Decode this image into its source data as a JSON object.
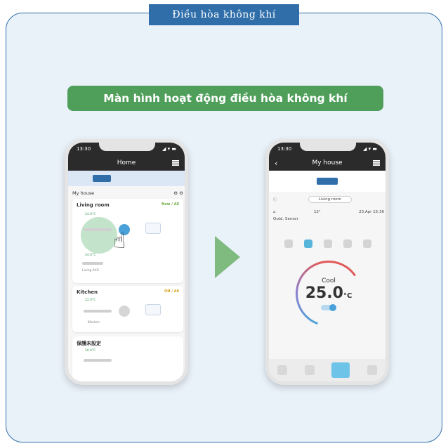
{
  "header": {
    "tab_title": "Điều hòa không khí"
  },
  "banner": {
    "title": "Màn hình hoạt động điều hòa không khí"
  },
  "colors": {
    "frame": "#2f6ea9",
    "banner": "#4f9e5a",
    "arrow": "#7fba7f"
  },
  "left_phone": {
    "status_time": "13:30",
    "status_icons": "◢ ▾ ▬",
    "app_title": "Home",
    "house_label": "My house",
    "rooms": [
      {
        "name": "Living room",
        "status": "Now / All",
        "temp_top": "24.0°C",
        "label": "Living ACS",
        "temp_bottom": "24.0°C"
      },
      {
        "name": "Kitchen",
        "status": "ON / All",
        "temp_top": "22.0°C",
        "label": "Kitchen"
      },
      {
        "name": "保護未設定",
        "temp_top": "20.0°C"
      }
    ]
  },
  "right_phone": {
    "status_time": "13:30",
    "app_title": "My house",
    "room_select": "Living room",
    "weather": "12°",
    "date_time": "23.Apr  15:36",
    "outdoor_label": "Outd. Sensor",
    "mode": "Cool",
    "temperature": "25.0",
    "unit": "°C"
  }
}
